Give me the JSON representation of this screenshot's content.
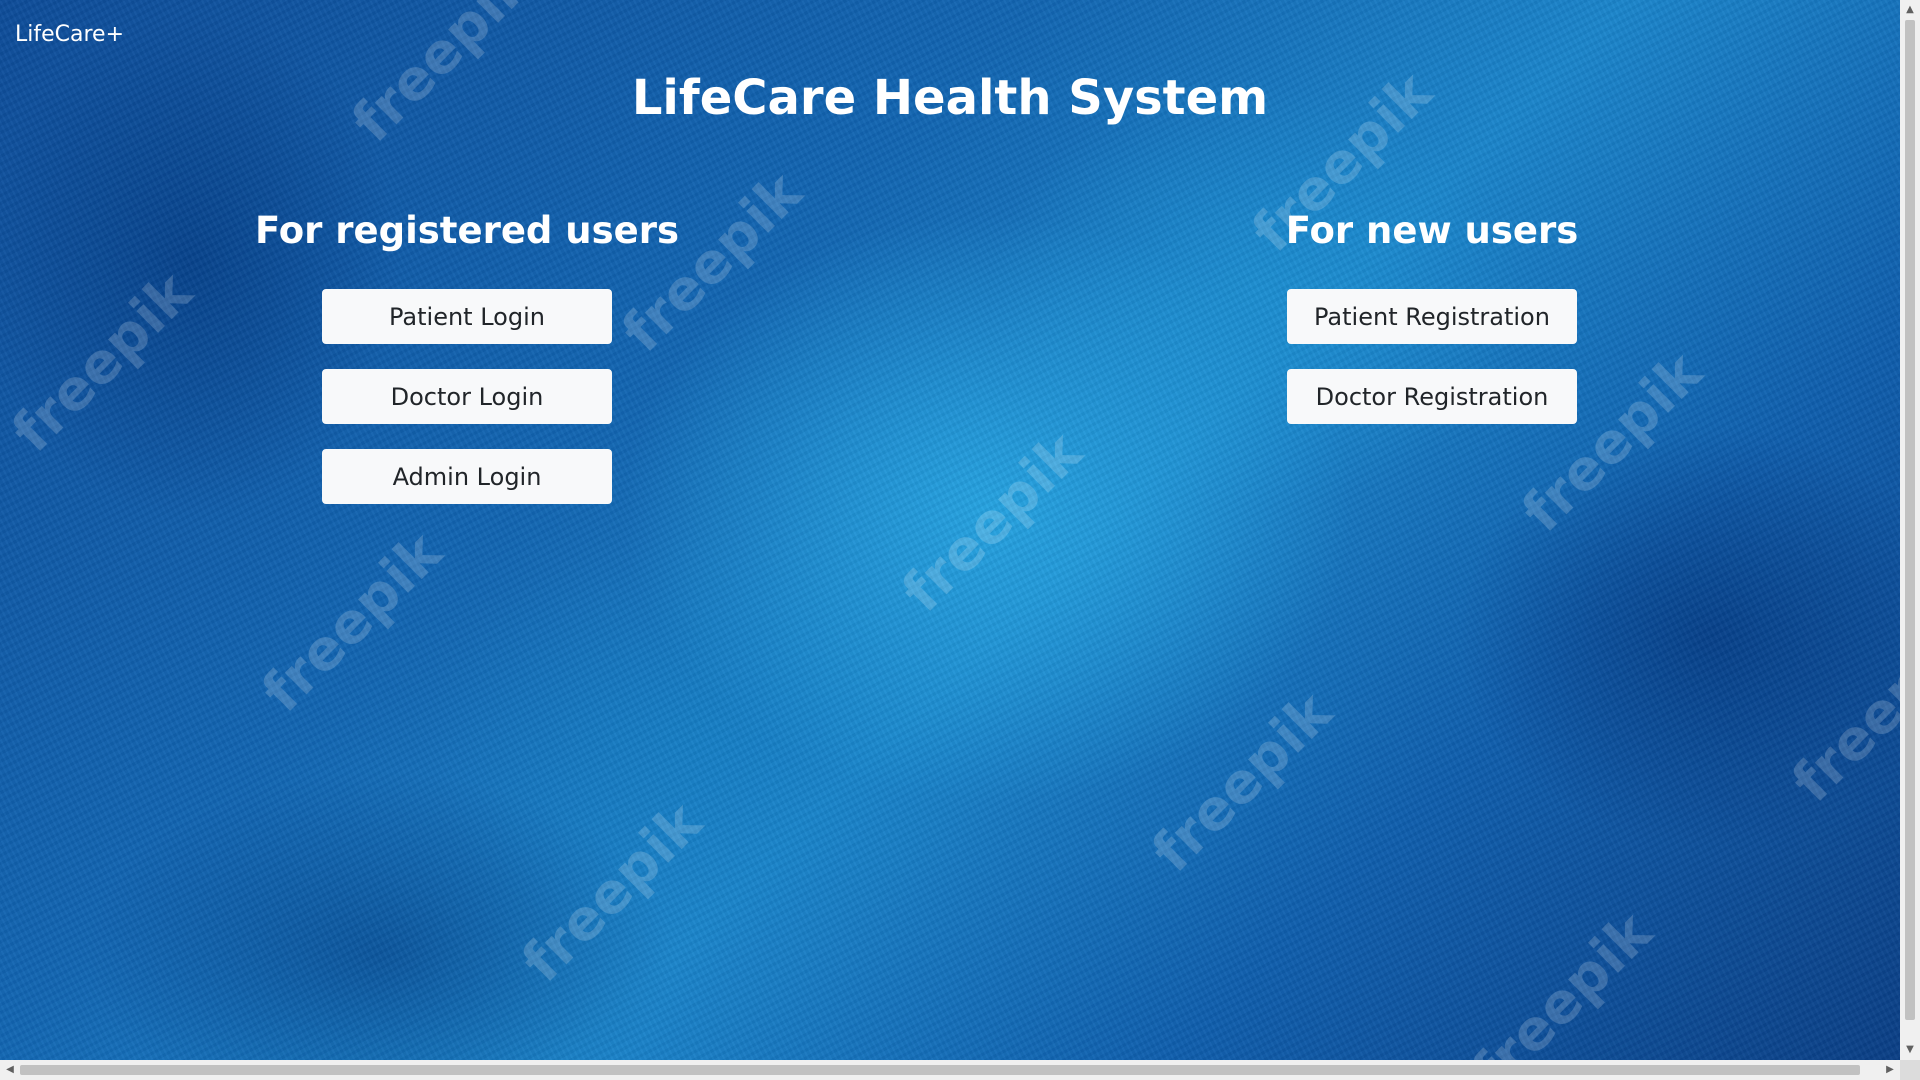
{
  "navbar": {
    "brand": "LifeCare+"
  },
  "main": {
    "title": "LifeCare Health System",
    "registered": {
      "heading": "For registered users",
      "buttons": [
        "Patient Login",
        "Doctor Login",
        "Admin Login"
      ]
    },
    "new_users": {
      "heading": "For new users",
      "buttons": [
        "Patient Registration",
        "Doctor Registration"
      ]
    }
  },
  "watermark": {
    "text": "freepik"
  },
  "colors": {
    "background_primary": "#1266b3",
    "background_light": "#28aae6",
    "button_bg": "#f8f9fa",
    "button_text": "#212529",
    "text": "#ffffff"
  },
  "icons": {
    "scroll_up": "triangle-up",
    "scroll_down": "triangle-down",
    "scroll_left": "triangle-left",
    "scroll_right": "triangle-right"
  }
}
